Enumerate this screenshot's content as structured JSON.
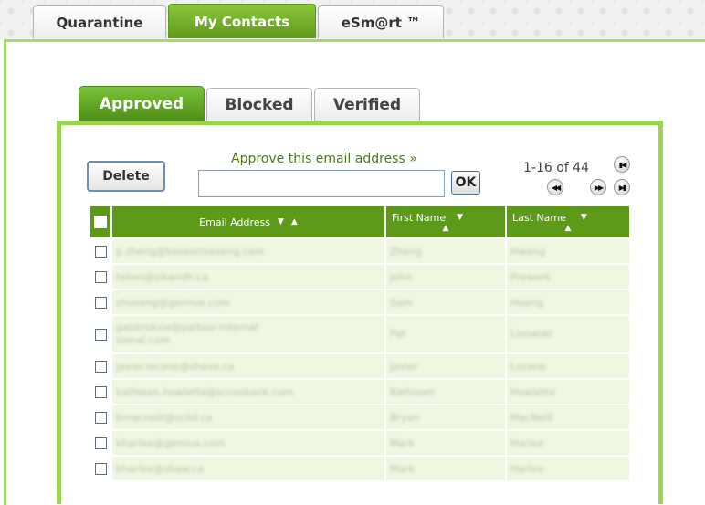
{
  "top_tabs": [
    {
      "label": "Quarantine",
      "active": false
    },
    {
      "label": "My Contacts",
      "active": true
    },
    {
      "label": "eSm@rt ™",
      "active": false
    }
  ],
  "sub_tabs": [
    {
      "label": "Approved",
      "active": true
    },
    {
      "label": "Blocked",
      "active": false
    },
    {
      "label": "Verified",
      "active": false
    }
  ],
  "toolbar": {
    "delete_label": "Delete",
    "approve_label": "Approve this email address »",
    "approve_value": "",
    "ok_label": "OK",
    "page_count": "1-16 of 44"
  },
  "pager_icons": [
    "first-page-icon",
    "previous-page-icon",
    "next-page-icon",
    "last-page-icon"
  ],
  "table": {
    "headers": {
      "email": "Email Address",
      "first_name": "First Name",
      "last_name": "Last Name"
    },
    "rows": [
      {
        "email": "p.zheng@bosestreeseng.com",
        "first": "Zheng",
        "last": "Hwang"
      },
      {
        "email": "tellen@sikandh.ca",
        "first": "John",
        "last": "Prewerk"
      },
      {
        "email": "shuseng@gennus.com",
        "first": "Sam",
        "last": "Huang"
      },
      {
        "email": "gabbroksie@paltsor-internatsional.com",
        "first": "Pat",
        "last": "Lisowski"
      },
      {
        "email": "javier.locano@shave.ca",
        "first": "Javier",
        "last": "Lozano"
      },
      {
        "email": "kathleen.howlette@sccosbank.com",
        "first": "Kathleen",
        "last": "Howlette"
      },
      {
        "email": "bmacneill@sclid.ca",
        "first": "Bryan",
        "last": "MacNeill"
      },
      {
        "email": "kharlee@gennus.com",
        "first": "Mark",
        "last": "Harlee"
      },
      {
        "email": "kharlee@shaw.ca",
        "first": "Mark",
        "last": "Harlee"
      }
    ]
  },
  "colors": {
    "accent_green": "#8cc63f",
    "header_green": "#5e9a1a",
    "row_bg": "#eff6e2",
    "label_green": "#4a7a16"
  }
}
